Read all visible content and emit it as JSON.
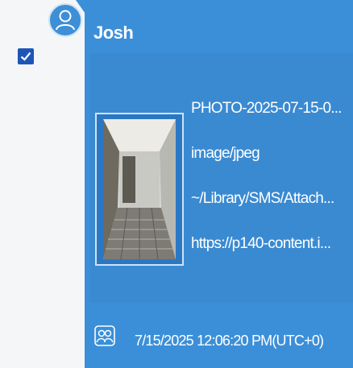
{
  "message": {
    "sender": "Josh",
    "selected": true,
    "attachment": {
      "filename": "PHOTO-2025-07-15-0...",
      "mime_type": "image/jpeg",
      "path": "~/Library/SMS/Attach...",
      "url": "https://p140-content.i..."
    },
    "timestamp": "7/15/2025 12:06:20 PM(UTC+0)"
  },
  "icons": {
    "checkbox": "checkmark-icon",
    "avatar": "user-avatar-icon",
    "thumbnail": "image-thumbnail",
    "footer": "contacts-icon"
  },
  "colors": {
    "bubble": "#3b8fd8",
    "checkbox": "#1e56b8",
    "text": "#ffffff"
  }
}
